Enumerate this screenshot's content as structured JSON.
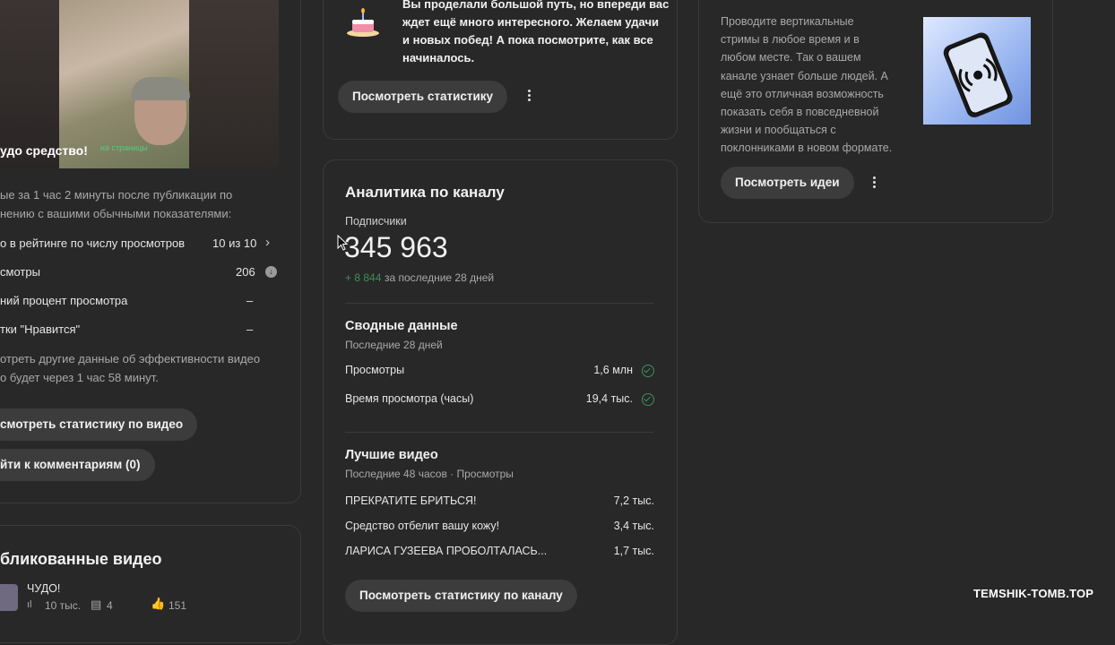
{
  "left": {
    "thumb_caption": "удо средство!",
    "thumb_badge": "на страницы",
    "intro_line1": "ые за 1 час 2 минуты после публикации по",
    "intro_line2": "нению с вашими обычными показателями:",
    "metrics": [
      {
        "label": "о в рейтинге по числу просмотров",
        "value": "10 из 10"
      },
      {
        "label": "смотры",
        "value": "206"
      },
      {
        "label": "ний процент просмотра",
        "value": "–"
      },
      {
        "label": "тки \"Нравится\"",
        "value": "–"
      }
    ],
    "note_line1": "отреть другие данные об эффективности видео",
    "note_line2": "о будет через 1 час 58 минут.",
    "btn_stats": "смотреть статистику по видео",
    "btn_comments": "йти к комментариям (0)",
    "published_title": "бликованные видео",
    "video_title": "ЧУДО!",
    "video_views": "10 тыс.",
    "video_comments": "4",
    "video_likes": "151"
  },
  "middle": {
    "congrats_line1": "Вы проделали большой путь, но впереди вас",
    "congrats_line2": "ждет ещё много интересного. Желаем удачи",
    "congrats_line3": "и новых побед! А пока посмотрите, как все",
    "congrats_line4": "начиналось.",
    "btn_view_stats": "Посмотреть статистику",
    "analytics_title": "Аналитика по каналу",
    "subs_label": "Подписчики",
    "subs_value": "345 963",
    "subs_delta": "+ 8 844",
    "subs_delta_period": "за последние 28 дней",
    "summary_title": "Сводные данные",
    "summary_period": "Последние 28 дней",
    "summary_rows": [
      {
        "label": "Просмотры",
        "value": "1,6 млн"
      },
      {
        "label": "Время просмотра (часы)",
        "value": "19,4 тыс."
      }
    ],
    "top_title": "Лучшие видео",
    "top_period": "Последние 48 часов · Просмотры",
    "top_videos": [
      {
        "title": "ПРЕКРАТИТЕ БРИТЬСЯ!",
        "views": "7,2 тыс."
      },
      {
        "title": "Средство отбелит вашу кожу!",
        "views": "3,4 тыс."
      },
      {
        "title": "ЛАРИСА ГУЗЕЕВА ПРОБОЛТАЛАСЬ...",
        "views": "1,7 тыс."
      }
    ],
    "btn_channel_stats": "Посмотреть статистику по каналу"
  },
  "right": {
    "desc_lines": [
      "Проводите вертикальные",
      "стримы в любое время и в",
      "любом месте. Так о вашем",
      "канале узнает больше людей. А",
      "ещё это отличная возможность",
      "показать себя в повседневной",
      "жизни и пообщаться с",
      "поклонниками в новом формате."
    ],
    "btn_ideas": "Посмотреть идеи"
  },
  "watermark": "TEMSHIK-TOMB.TOP",
  "colors": {
    "background": "#282828",
    "positive": "#3f8f5a",
    "button": "#3c3c3c"
  }
}
